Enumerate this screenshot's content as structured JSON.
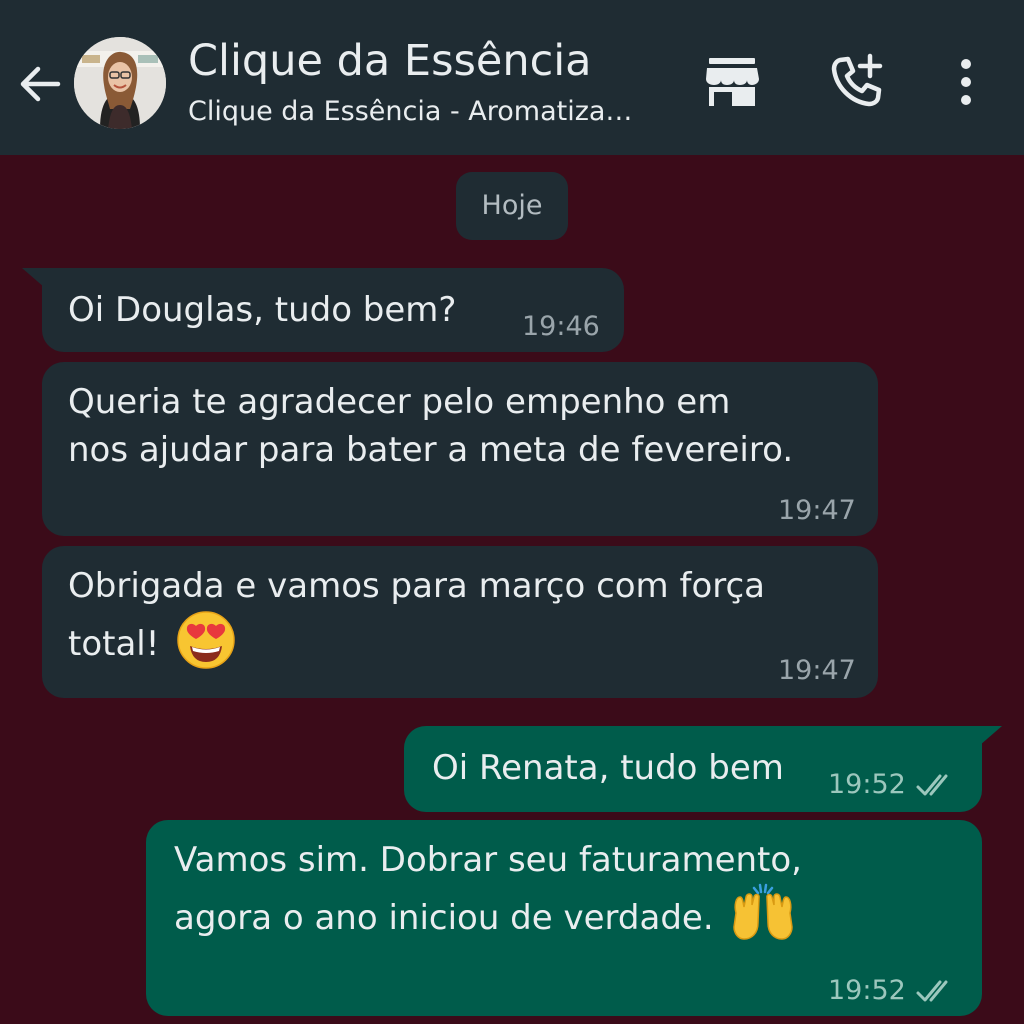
{
  "header": {
    "title": "Clique da Essência",
    "subtitle": "Clique da Essência - Aromatiza…",
    "icons": [
      "arrow-left-icon",
      "store-icon",
      "add-call-icon",
      "more-vertical-icon"
    ]
  },
  "chat": {
    "date_label": "Hoje",
    "messages": [
      {
        "direction": "incoming",
        "text_lines": [
          "Oi Douglas, tudo bem?"
        ],
        "time": "19:46"
      },
      {
        "direction": "incoming",
        "text_lines": [
          "Queria te agradecer pelo empenho em",
          "nos ajudar para bater a meta de fevereiro."
        ],
        "time": "19:47"
      },
      {
        "direction": "incoming",
        "text_lines": [
          "Obrigada e vamos para março com força",
          "total!"
        ],
        "emoji": "heart-eyes-emoji",
        "time": "19:47"
      },
      {
        "direction": "outgoing",
        "text_lines": [
          "Oi Renata, tudo bem"
        ],
        "time": "19:52",
        "status": "read"
      },
      {
        "direction": "outgoing",
        "text_lines": [
          "Vamos sim. Dobrar seu faturamento,",
          "agora o ano iniciou de verdade."
        ],
        "emoji": "raising-hands-emoji",
        "time": "19:52",
        "status": "read"
      }
    ]
  },
  "colors": {
    "header_bg": "#1f2c33",
    "chat_bg": "#3b0b19",
    "incoming_bubble": "#1f2c33",
    "outgoing_bubble": "#005c4b",
    "text": "#e9edef",
    "meta": "#9aa5ab"
  }
}
